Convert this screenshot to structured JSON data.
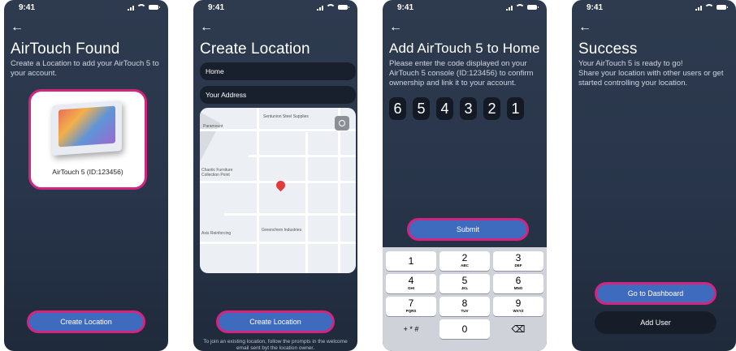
{
  "status": {
    "time": "9:41"
  },
  "screen1": {
    "back": "←",
    "title": "AirTouch Found",
    "description": "Create a Location to add your AirTouch 5 to your account.",
    "device_label": "AirTouch 5 (ID:123456)",
    "button": "Create Location"
  },
  "screen2": {
    "back": "←",
    "title": "Create Location",
    "name_field": "Home",
    "address_field": "Your Address",
    "map_labels": {
      "supplies": "Sentunion Steel Supplies",
      "place": "Paramount",
      "furniture": "Chaotic Furniture\nCollection Point",
      "industries": "Greenchem Industries",
      "reinforcing": "Axis Reinforcing"
    },
    "button": "Create Location",
    "footnote": "To join an existing location, follow the prompts in the welcome email sent byt the location owner."
  },
  "screen3": {
    "back": "←",
    "title": "Add AirTouch 5 to Home",
    "description": "Please enter the code displayed on your AirTouch 5 console (ID:123456) to confirm ownership and link it to your account.",
    "code": [
      "6",
      "5",
      "4",
      "3",
      "2",
      "1"
    ],
    "button": "Submit",
    "keys": [
      {
        "n": "1",
        "l": ""
      },
      {
        "n": "2",
        "l": "ABC"
      },
      {
        "n": "3",
        "l": "DEF"
      },
      {
        "n": "4",
        "l": "GHI"
      },
      {
        "n": "5",
        "l": "JKL"
      },
      {
        "n": "6",
        "l": "MNO"
      },
      {
        "n": "7",
        "l": "PQRS"
      },
      {
        "n": "8",
        "l": "TUV"
      },
      {
        "n": "9",
        "l": "WXYZ"
      },
      {
        "n": "+ * #",
        "l": ""
      },
      {
        "n": "0",
        "l": ""
      },
      {
        "n": "⌫",
        "l": ""
      }
    ]
  },
  "screen4": {
    "back": "←",
    "title": "Success",
    "description": "Your AirTouch 5 is ready to go!\nShare your location with other users or get started controlling your location.",
    "primary_button": "Go to Dashboard",
    "secondary_button": "Add User"
  },
  "colors": {
    "accent": "#d3247f",
    "primary": "#3f6bbf",
    "background": "#2b384c"
  }
}
